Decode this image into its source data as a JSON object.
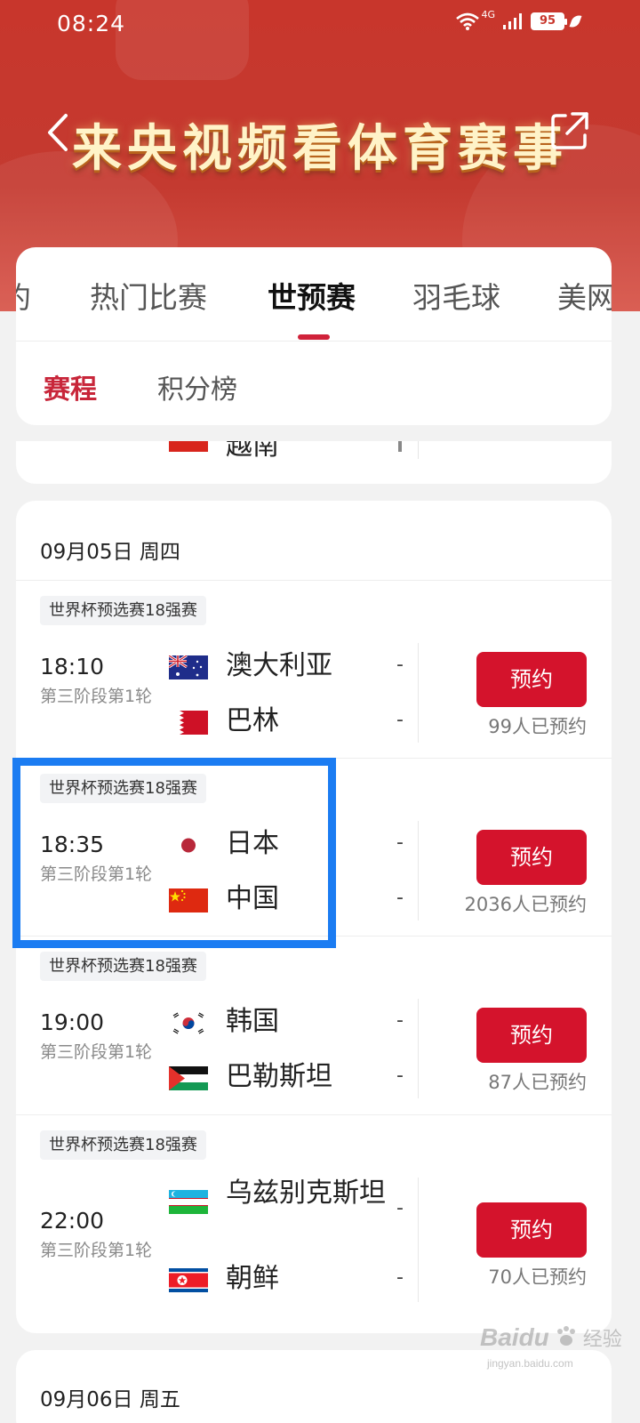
{
  "status_bar": {
    "time": "08:24",
    "network": "4G",
    "battery": "95"
  },
  "header": {
    "banner_title": "来央视频看体育赛事"
  },
  "tabs": [
    {
      "label": "约",
      "active": false
    },
    {
      "label": "热门比赛",
      "active": false
    },
    {
      "label": "世预赛",
      "active": true
    },
    {
      "label": "羽毛球",
      "active": false
    },
    {
      "label": "美网",
      "active": false
    }
  ],
  "subtabs": [
    {
      "label": "赛程",
      "active": true
    },
    {
      "label": "积分榜",
      "active": false
    }
  ],
  "partial_match": {
    "team": "越南"
  },
  "schedule": {
    "date": "09月05日 周四",
    "matches": [
      {
        "tag": "世界杯预选赛18强赛",
        "time": "18:10",
        "stage": "第三阶段第1轮",
        "home": {
          "name": "澳大利亚",
          "flag": "australia-flag-icon",
          "score": "-"
        },
        "away": {
          "name": "巴林",
          "flag": "bahrain-flag-icon",
          "score": "-"
        },
        "button": "预约",
        "reserve_count": "99人已预约"
      },
      {
        "tag": "世界杯预选赛18强赛",
        "time": "18:35",
        "stage": "第三阶段第1轮",
        "home": {
          "name": "日本",
          "flag": "japan-flag-icon",
          "score": "-"
        },
        "away": {
          "name": "中国",
          "flag": "china-flag-icon",
          "score": "-"
        },
        "button": "预约",
        "reserve_count": "2036人已预约"
      },
      {
        "tag": "世界杯预选赛18强赛",
        "time": "19:00",
        "stage": "第三阶段第1轮",
        "home": {
          "name": "韩国",
          "flag": "korea-flag-icon",
          "score": "-"
        },
        "away": {
          "name": "巴勒斯坦",
          "flag": "palestine-flag-icon",
          "score": "-"
        },
        "button": "预约",
        "reserve_count": "87人已预约"
      },
      {
        "tag": "世界杯预选赛18强赛",
        "time": "22:00",
        "stage": "第三阶段第1轮",
        "home": {
          "name": "乌兹别克斯坦",
          "flag": "uzbekistan-flag-icon",
          "score": "-"
        },
        "away": {
          "name": "朝鲜",
          "flag": "north-korea-flag-icon",
          "score": "-"
        },
        "button": "预约",
        "reserve_count": "70人已预约"
      }
    ]
  },
  "next_date": "09月06日 周五",
  "watermark": {
    "logo": "Baidu",
    "text": "经验",
    "sub": "jingyan.baidu.com"
  },
  "colors": {
    "header_red": "#c8362c",
    "accent_red": "#d4132c",
    "highlight_blue": "#1b7cf2"
  }
}
